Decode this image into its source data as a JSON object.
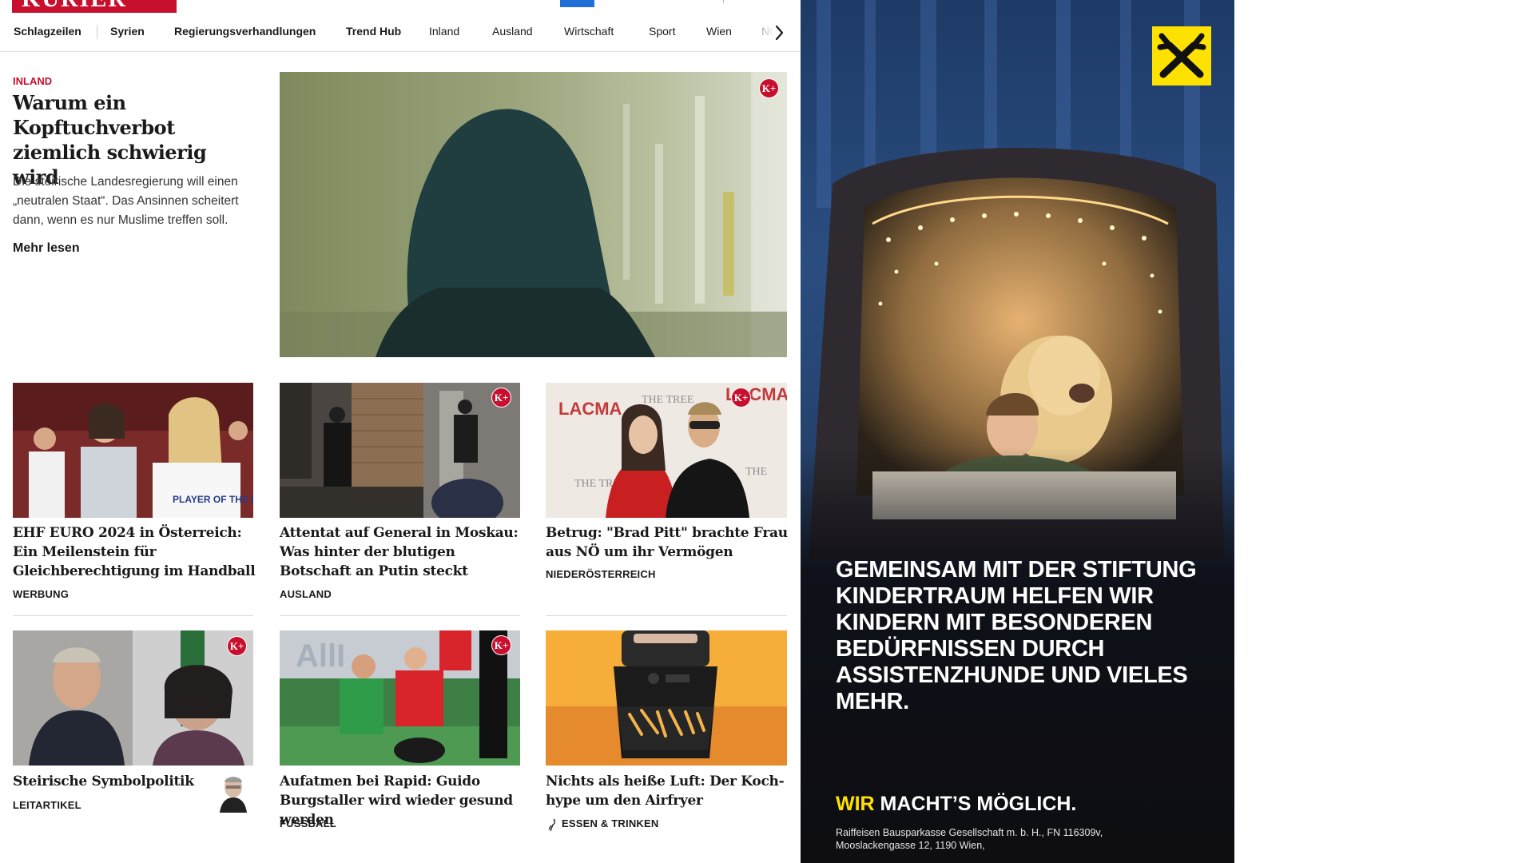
{
  "brand": {
    "logo_text": "KURIER",
    "accent": "#c8102e",
    "tab_accent": "#1f6fd6"
  },
  "nav": {
    "items": [
      {
        "label": "Schlagzeilen",
        "strong": true
      },
      {
        "label": "Syrien",
        "strong": true
      },
      {
        "label": "Regierungsverhandlungen",
        "strong": true
      },
      {
        "label": "Trend Hub",
        "strong": true
      },
      {
        "label": "Inland",
        "strong": false
      },
      {
        "label": "Ausland",
        "strong": false
      },
      {
        "label": "Wirtschaft",
        "strong": false
      },
      {
        "label": "Sport",
        "strong": false
      },
      {
        "label": "Wien",
        "strong": false
      },
      {
        "label": "NÖ",
        "strong": false
      }
    ],
    "next_icon": "chevron-right-icon"
  },
  "lead": {
    "kicker": "INLAND",
    "title": "Warum ein Kopftuchver­bot ziemlich schwierig wird",
    "teaser": "Die steirische Landesregierung will einen „neutralen Staat“. Das Ansinnen scheitert dann, wenn es nur Muslime treffen soll.",
    "read_more": "Mehr lesen",
    "badge": "K+"
  },
  "cards": [
    {
      "title": "EHF EURO 2024 in Österreich: Ein Meilenstein für Gleichberechti­gung im Handball",
      "category": "WERBUNG",
      "badge": ""
    },
    {
      "title": "Attentat auf General in Moskau: Was hinter der blutigen Botschaft an Putin steckt",
      "category": "AUSLAND",
      "badge": "K+"
    },
    {
      "title": "Betrug: \"Brad Pitt\" brachte Frau aus NÖ um ihr Vermögen",
      "category": "NIEDERÖSTERREICH",
      "badge": "K+"
    },
    {
      "title": "Steirische Symbolpolitik",
      "category": "LEITARTIKEL",
      "badge": "K+"
    },
    {
      "title": "Aufatmen bei Rapid: Guido Burg­staller wird wieder gesund werden",
      "category": "FUSSBALL",
      "badge": "K+"
    },
    {
      "title": "Nichts als heiße Luft: Der Koch­hype um den Airfryer",
      "category": "ESSEN & TRINKEN",
      "badge": ""
    }
  ],
  "ad": {
    "headline": "GEMEINSAM MIT DER STIFTUNG KINDERTRAUM HELFEN WIR KINDERN MIT BESONDEREN BEDÜRFNISSEN DURCH ASSISTENZHUNDE UND VIELES MEHR.",
    "slogan_highlight": "WIR",
    "slogan_rest": " MACHT’S MÖGLICH.",
    "legal": "Raiffeisen Bausparkasse Gesellschaft m. b. H., FN 116309v, Mooslackengasse 12, 1190 Wien,",
    "logo_color": "#ffe100"
  }
}
